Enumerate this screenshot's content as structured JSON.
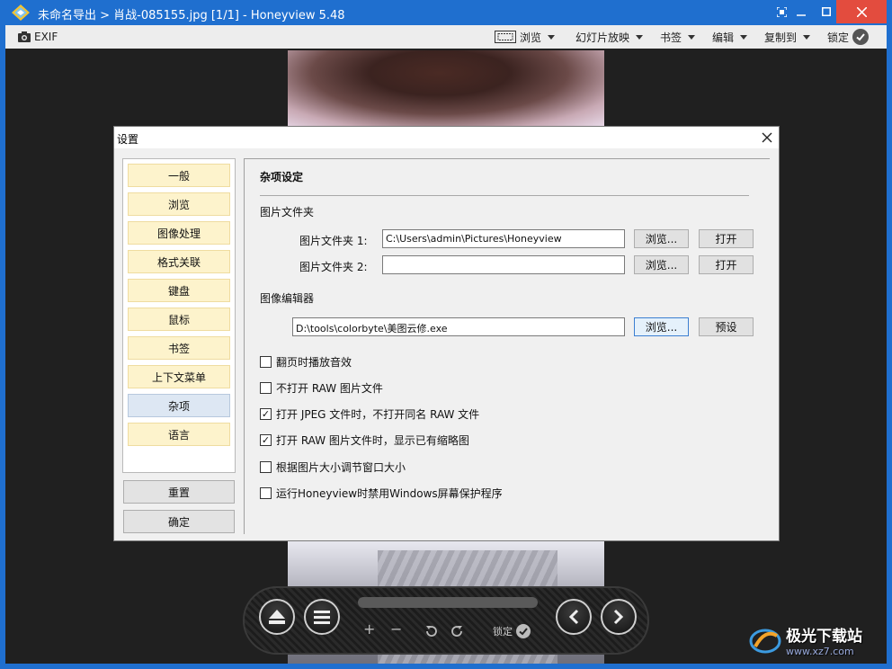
{
  "window": {
    "title": "未命名导出 > 肖战-085155.jpg [1/1] - Honeyview 5.48"
  },
  "toolbar": {
    "exif": "EXIF",
    "browse": "浏览",
    "slideshow": "幻灯片放映",
    "bookmark": "书签",
    "edit": "编辑",
    "copy_to": "复制到",
    "lock": "锁定"
  },
  "controlbar": {
    "plus": "+",
    "minus": "−",
    "lock": "锁定"
  },
  "dialog": {
    "title": "设置",
    "nav_items": [
      "一般",
      "浏览",
      "图像处理",
      "格式关联",
      "键盘",
      "鼠标",
      "书签",
      "上下文菜单",
      "杂项",
      "语言"
    ],
    "active_item": "杂项",
    "reset": "重置",
    "ok": "确定",
    "content": {
      "heading": "杂项设定",
      "picture_folder_section": "图片文件夹",
      "folder1_label": "图片文件夹 1:",
      "folder1_value": "C:\\Users\\admin\\Pictures\\Honeyview",
      "folder2_label": "图片文件夹 2:",
      "folder2_value": "",
      "browse_btn": "浏览...",
      "open_btn": "打开",
      "editor_section": "图像编辑器",
      "editor_value": "D:\\tools\\colorbyte\\美图云修.exe",
      "preset_btn": "预设",
      "checkboxes": [
        {
          "label": "翻页时播放音效",
          "checked": false
        },
        {
          "label": "不打开 RAW 图片文件",
          "checked": false
        },
        {
          "label": "打开 JPEG 文件时，不打开同名 RAW 文件",
          "checked": true
        },
        {
          "label": "打开 RAW 图片文件时，显示已有缩略图",
          "checked": true
        },
        {
          "label": "根据图片大小调节窗口大小",
          "checked": false
        },
        {
          "label": "运行Honeyview时禁用Windows屏幕保护程序",
          "checked": false
        }
      ]
    }
  },
  "watermark": {
    "name": "极光下载站",
    "url": "www.xz7.com"
  }
}
